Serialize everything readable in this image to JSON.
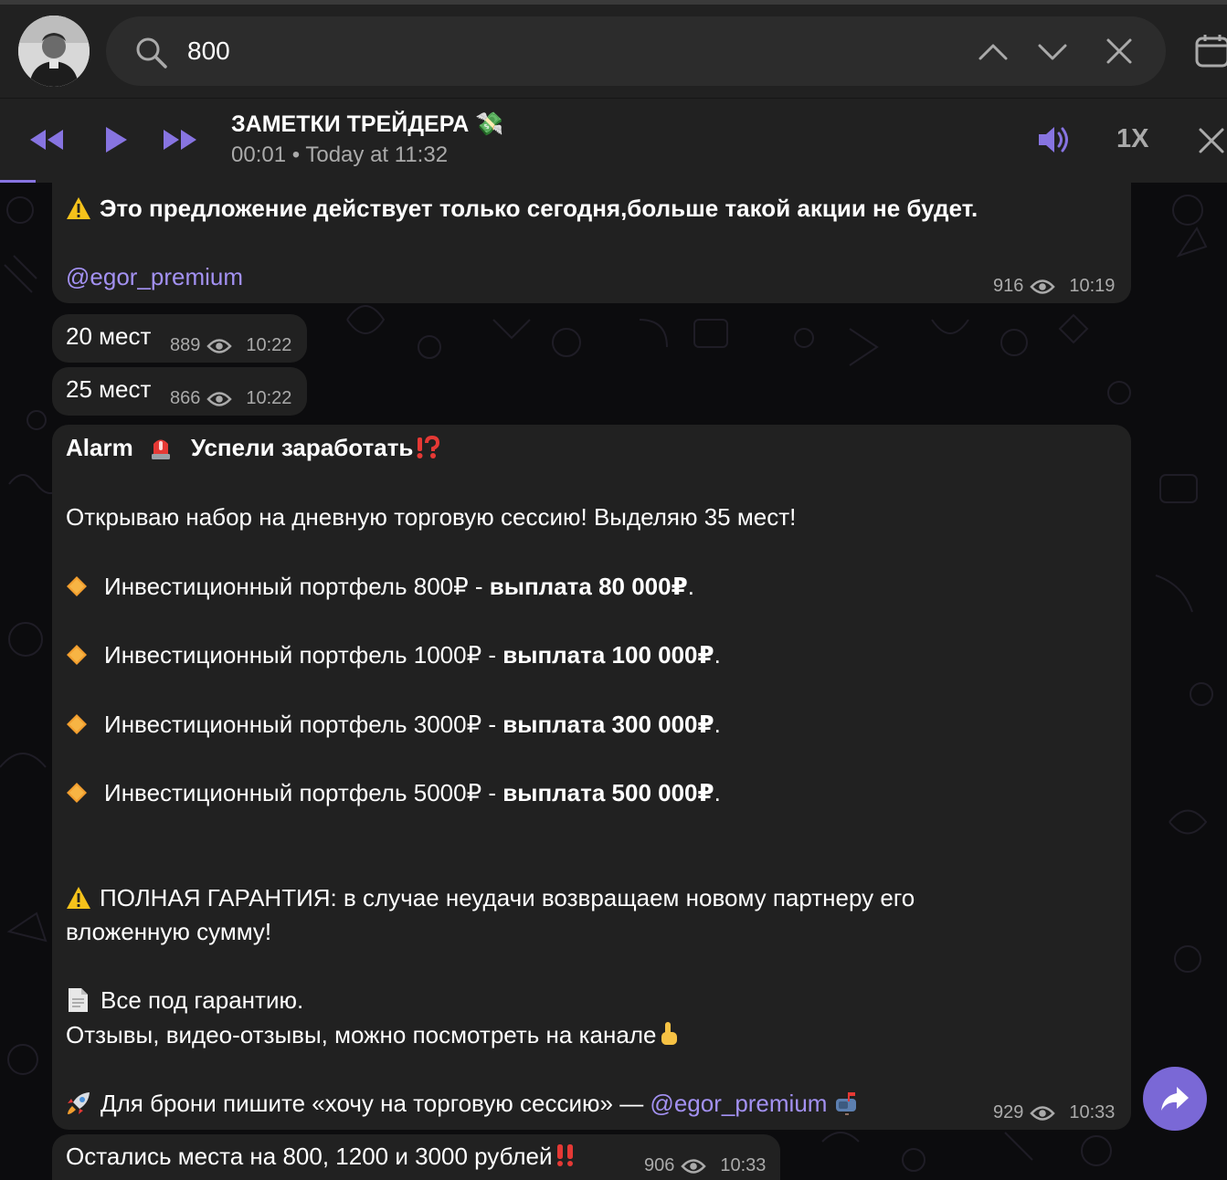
{
  "search": {
    "query": "800"
  },
  "player": {
    "title": "ЗАМЕТКИ ТРЕЙДЕРА 💸",
    "subtitle": "00:01 • Today at 11:32",
    "speed": "1X",
    "progress_fraction": 0.03
  },
  "messages": {
    "m1": {
      "text": "Это предложение действует только сегодня,больше такой акции не будет.",
      "link": "@egor_premium",
      "views": "916",
      "time": "10:19"
    },
    "m2": {
      "text": "20 мест",
      "views": "889",
      "time": "10:22"
    },
    "m3": {
      "text": "25 мест",
      "views": "866",
      "time": "10:22"
    },
    "m4": {
      "alarm": "Alarm",
      "headline": "Успели заработать",
      "intro": "Открываю набор на дневную торговую сессию! Выделяю 35 мест!",
      "items": [
        {
          "plain": "Инвестиционный портфель 800₽ - ",
          "bold": "выплата 80 000₽",
          "end": "."
        },
        {
          "plain": "Инвестиционный портфель 1000₽ - ",
          "bold": "выплата 100 000₽",
          "end": "."
        },
        {
          "plain": "Инвестиционный портфель 3000₽ - ",
          "bold": "выплата 300 000₽",
          "end": "."
        },
        {
          "plain": "Инвестиционный портфель 5000₽ - ",
          "bold": "выплата 500 000₽",
          "end": "."
        }
      ],
      "guarantee_line1": "ПОЛНАЯ ГАРАНТИЯ: в случае неудачи возвращаем новому партнеру его",
      "guarantee_line2": "вложенную сумму!",
      "doc_line": "Все под гарантию.",
      "reviews_line": "Отзывы, видео-отзывы, можно посмотреть на канале",
      "booking_text": "Для брони пишите  «хочу на торговую сессию» — ",
      "booking_link": "@egor_premium",
      "views": "929",
      "time": "10:33"
    },
    "m5": {
      "text": "Остались места на 800, 1200 и 3000 рублей",
      "views": "906",
      "time": "10:33"
    }
  },
  "colors": {
    "accent": "#8774e1",
    "link": "#a391f2",
    "bubble": "#212121",
    "bar": "#212121"
  }
}
